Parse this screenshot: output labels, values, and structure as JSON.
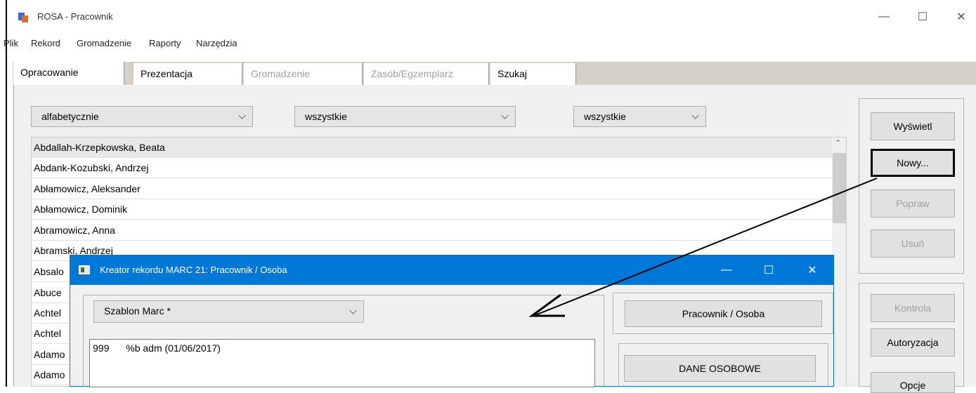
{
  "window": {
    "title": "ROSA - Pracownik",
    "minimize": "—",
    "maximize": "☐",
    "close": "✕"
  },
  "menu": [
    "Plik",
    "Rekord",
    "Gromadzenie",
    "Raporty",
    "Narzędzia"
  ],
  "tabs": [
    {
      "label": "Opracowanie",
      "enabled": true
    },
    {
      "label": "Prezentacja",
      "enabled": true
    },
    {
      "label": "Gromadzenie",
      "enabled": false
    },
    {
      "label": "Zasób/Egzemplarz",
      "enabled": false
    },
    {
      "label": "Szukaj",
      "enabled": true
    }
  ],
  "filters": {
    "sort": "alfabetycznie",
    "filter1": "wszystkie",
    "filter2": "wszystkie"
  },
  "list_items": [
    "Abdallah-Krzepkowska, Beata",
    "Abdank-Kozubski, Andrzej",
    "Abłamowicz, Aleksander",
    "Abłamowicz, Dominik",
    "Abramowicz, Anna",
    "Abramski, Andrzej",
    "Absalo",
    "Abuce",
    "Achtel",
    "Achtel",
    "Adamo",
    "Adamo"
  ],
  "actions": {
    "show": "Wyświetl",
    "new": "Nowy...",
    "edit": "Popraw",
    "delete": "Usuń"
  },
  "actions2": {
    "check": "Kontrola",
    "authorize": "Autoryzacja",
    "options": "Opcje"
  },
  "dialog": {
    "title": "Kreator rekordu MARC 21: Pracownik / Osoba",
    "template": "Szablon Marc *",
    "marc_tag": "999",
    "marc_value": "%b adm (01/06/2017)",
    "type_button": "Pracownik / Osoba",
    "section_button": "DANE OSOBOWE",
    "minimize": "—",
    "maximize": "☐",
    "close": "✕"
  },
  "colors": {
    "accent": "#0078d7",
    "highlight_box": "#000000"
  }
}
